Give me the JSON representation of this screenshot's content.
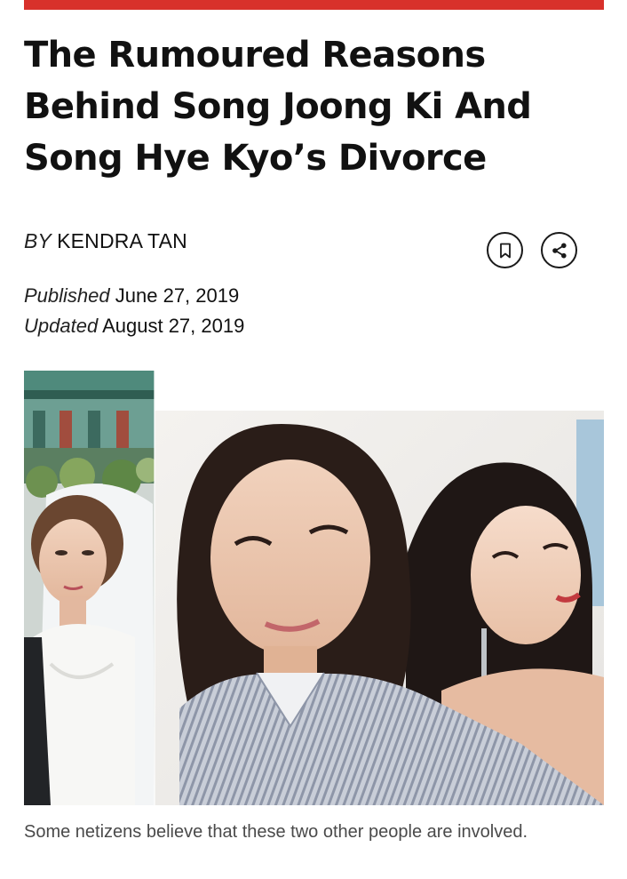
{
  "article": {
    "title": "The Rumoured Reasons Behind Song Joong Ki And Song Hye Kyo’s Divorce",
    "byline": {
      "prefix": "BY",
      "author": "KENDRA TAN"
    },
    "published": {
      "label": "Published",
      "date": "June 27, 2019"
    },
    "updated": {
      "label": "Updated",
      "date": "August 27, 2019"
    },
    "image_caption": "Some netizens believe that these two other people are involved."
  },
  "actions": {
    "bookmark_icon": "bookmark-icon",
    "share_icon": "share-icon"
  },
  "colors": {
    "accent": "#d8312b",
    "text": "#111111",
    "caption": "#4a4a4a"
  }
}
